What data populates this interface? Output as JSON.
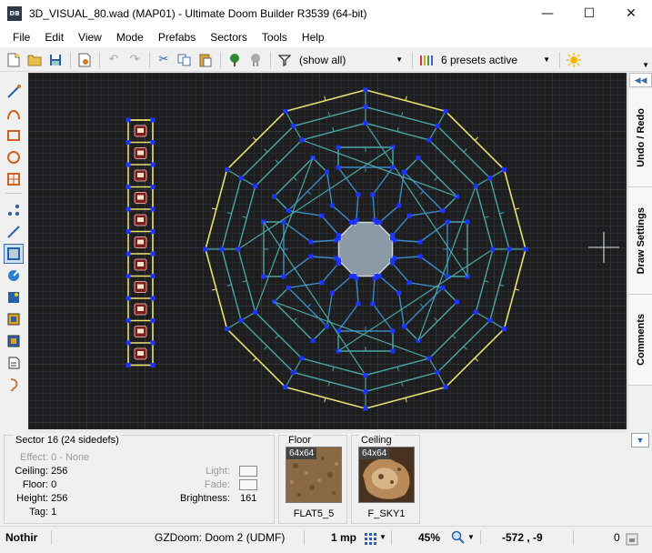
{
  "window": {
    "title": "3D_VISUAL_80.wad (MAP01) - Ultimate Doom Builder R3539 (64-bit)",
    "app_icon_text": "DB",
    "minimize_glyph": "—",
    "maximize_glyph": "☐",
    "close_glyph": "✕"
  },
  "menu": [
    "File",
    "Edit",
    "View",
    "Mode",
    "Prefabs",
    "Sectors",
    "Tools",
    "Help"
  ],
  "toolbar": {
    "filter_value": "(show all)",
    "presets_value": "6 presets active",
    "icons": [
      "new-map-icon",
      "open-map-icon",
      "save-map-icon",
      "map-options-icon",
      "undo-icon",
      "redo-icon",
      "cut-icon",
      "copy-icon",
      "paste-icon",
      "things-filter-icon",
      "cloud-icon",
      "filter-icon",
      "presets-icon",
      "brightness-icon"
    ]
  },
  "left_tools": [
    "draw-lines-icon",
    "draw-curve-icon",
    "draw-rectangle-icon",
    "draw-ellipse-icon",
    "draw-grid-icon",
    "vertices-mode-icon",
    "linedefs-mode-icon",
    "sectors-mode-icon",
    "things-mode-icon",
    "visual-mode-icon",
    "sector-effect-icon",
    "make-sector-icon",
    "script-icon",
    "sound-icon"
  ],
  "right_dock": {
    "tabs": [
      "Undo / Redo",
      "Draw Settings",
      "Comments"
    ]
  },
  "sector_info": {
    "title": "Sector 16 (24 sidedefs)",
    "effect_label": "Effect:",
    "effect_value": "0 - None",
    "ceiling_label": "Ceiling:",
    "ceiling_value": "256",
    "floor_label": "Floor:",
    "floor_value": "0",
    "height_label": "Height:",
    "height_value": "256",
    "tag_label": "Tag:",
    "tag_value": "1",
    "light_label": "Light:",
    "fade_label": "Fade:",
    "brightness_label": "Brightness:",
    "brightness_value": "161"
  },
  "floor_texture": {
    "title": "Floor",
    "size": "64x64",
    "name": "FLAT5_5",
    "color": "#8a6a45"
  },
  "ceiling_texture": {
    "title": "Ceiling",
    "size": "64x64",
    "name": "F_SKY1",
    "color": "#6b4a2e"
  },
  "status": {
    "message": "Nothir",
    "engine": "GZDoom: Doom 2 (UDMF)",
    "grid": "1 mp",
    "zoom": "45%",
    "coords": "-572 , -9",
    "extra": "0"
  },
  "colors": {
    "grid_minor": "#2c3440",
    "grid_major": "#3b4a5c",
    "line_teal": "#4aa6a6",
    "line_yellow": "#e8e070",
    "vertex_blue": "#1d33ff",
    "hub_fill": "#8c9aa8"
  }
}
